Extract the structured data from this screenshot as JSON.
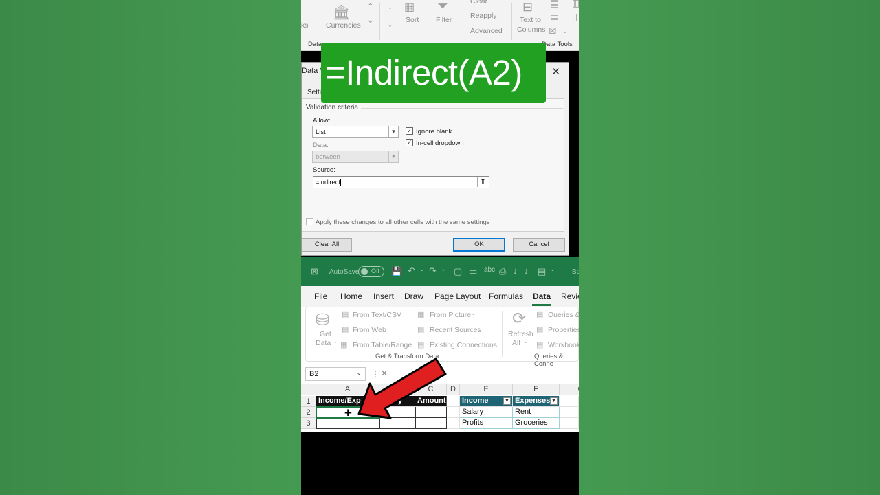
{
  "top_ribbon": {
    "items": [
      "ks",
      "Currencies",
      "Sort",
      "Filter",
      "Clear",
      "Reapply",
      "Advanced",
      "Text to",
      "Columns",
      "Data",
      "Data Tools"
    ]
  },
  "dialog": {
    "title": "Data Va",
    "tab": "Settin",
    "group_label": "Validation criteria",
    "allow_label": "Allow:",
    "allow_value": "List",
    "ignore_blank": "Ignore blank",
    "incell_dropdown": "In-cell dropdown",
    "data_label": "Data:",
    "data_value": "between",
    "source_label": "Source:",
    "source_value": "=indirect",
    "apply_all": "Apply these changes to all other cells with the same settings",
    "clear_all": "Clear All",
    "ok": "OK",
    "cancel": "Cancel"
  },
  "banner": {
    "text": "=Indirect(A2)"
  },
  "excel": {
    "autosave": "AutoSave",
    "autosave_state": "Off",
    "title_partial": "Bo",
    "menu": [
      "File",
      "Home",
      "Insert",
      "Draw",
      "Page Layout",
      "Formulas",
      "Data",
      "Revie"
    ],
    "ribbon": {
      "get_data": "Get",
      "get_data2": "Data",
      "from_text": "From Text/CSV",
      "from_web": "From Web",
      "from_table": "From Table/Range",
      "from_picture": "From Picture",
      "recent": "Recent Sources",
      "existing": "Existing Connections",
      "group1": "Get & Transform Data",
      "refresh": "Refresh",
      "refresh2": "All",
      "queries": "Queries &",
      "properties": "Properties",
      "workbook": "Workbook",
      "group2": "Queries & Conne"
    },
    "namebox": "B2",
    "columns": [
      "A",
      "C",
      "D",
      "E",
      "F",
      "G"
    ],
    "rows": [
      "1",
      "2",
      "3"
    ],
    "cells": {
      "a1": "Income/Exp",
      "b1": "egory",
      "c1": "Amount",
      "e1": "Income",
      "f1": "Expenses",
      "e2": "Salary",
      "f2": "Rent",
      "e3": "Profits",
      "f3": "Groceries"
    }
  },
  "colors": {
    "background": "#3f8f4c",
    "banner": "#21a022",
    "excel_green": "#1e7b45",
    "table_header": "#1f6474",
    "arrow": "#e02020"
  }
}
